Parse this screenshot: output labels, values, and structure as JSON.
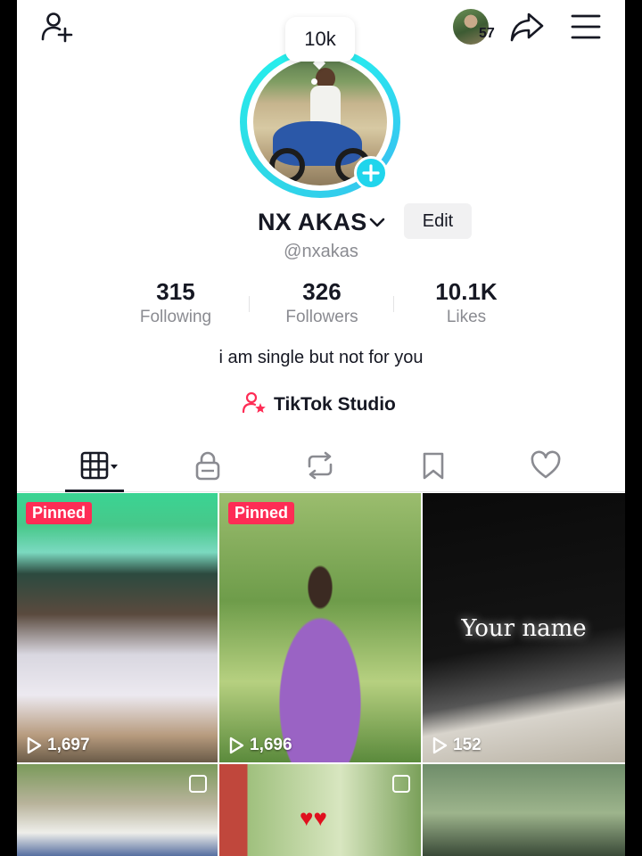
{
  "header": {
    "notification_count": "57"
  },
  "profile": {
    "bubble_text": "10k",
    "name": "NX AKAS",
    "edit_label": "Edit",
    "handle": "@nxakas",
    "bio": "i am single but not for you",
    "studio_label": "TikTok Studio"
  },
  "stats": [
    {
      "value": "315",
      "label": "Following"
    },
    {
      "value": "326",
      "label": "Followers"
    },
    {
      "value": "10.1K",
      "label": "Likes"
    }
  ],
  "tabs": [
    {
      "icon": "grid-icon",
      "active": true
    },
    {
      "icon": "lock-icon",
      "active": false
    },
    {
      "icon": "repost-icon",
      "active": false
    },
    {
      "icon": "bookmark-icon",
      "active": false
    },
    {
      "icon": "heart-icon",
      "active": false
    }
  ],
  "videos": [
    {
      "pinned_label": "Pinned",
      "views": "1,697"
    },
    {
      "pinned_label": "Pinned",
      "views": "1,696"
    },
    {
      "overlay_text": "Your name",
      "views": "152"
    },
    {
      "multi": true
    },
    {
      "multi": true
    },
    {}
  ],
  "colors": {
    "accent": "#20d5ec",
    "pinned": "#fe2c55",
    "text": "#161823",
    "muted": "#8a8b91"
  }
}
